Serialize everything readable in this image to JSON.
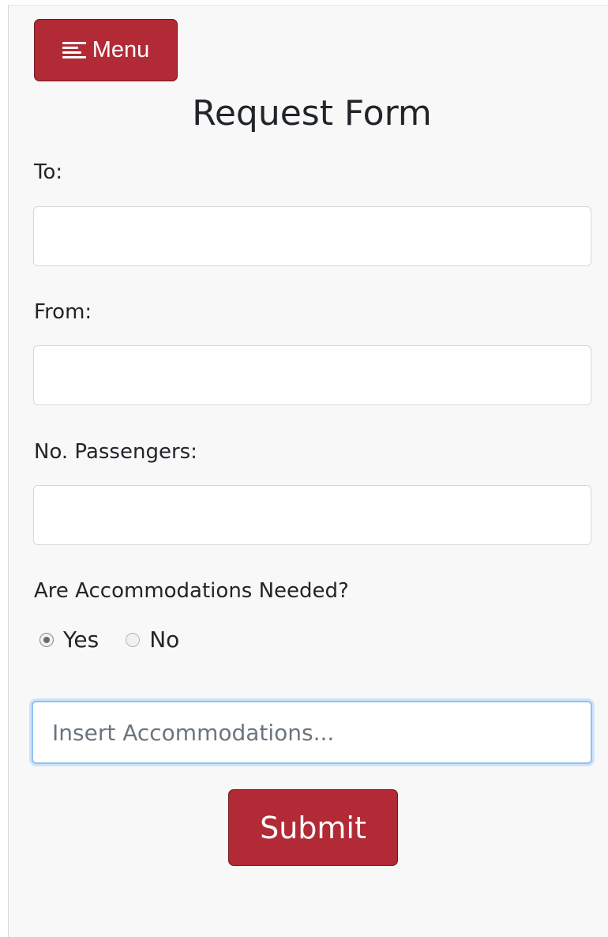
{
  "header": {
    "menu_label": "Menu",
    "menu_icon": "hamburger-menu-icon"
  },
  "form": {
    "title": "Request Form",
    "fields": [
      {
        "label": "To:",
        "value": "",
        "placeholder": ""
      },
      {
        "label": "From:",
        "value": "",
        "placeholder": ""
      },
      {
        "label": "No. Passengers:",
        "value": "",
        "placeholder": ""
      }
    ],
    "accommodations_question": "Are Accommodations Needed?",
    "radio_options": [
      {
        "label": "Yes",
        "checked": true
      },
      {
        "label": "No",
        "checked": false
      }
    ],
    "accommodations_input": {
      "value": "",
      "placeholder": "Insert Accommodations..."
    },
    "submit_label": "Submit"
  },
  "colors": {
    "primary_button": "#b12a35",
    "focus_ring": "#8fc1f3",
    "background": "#f8f8f8"
  }
}
